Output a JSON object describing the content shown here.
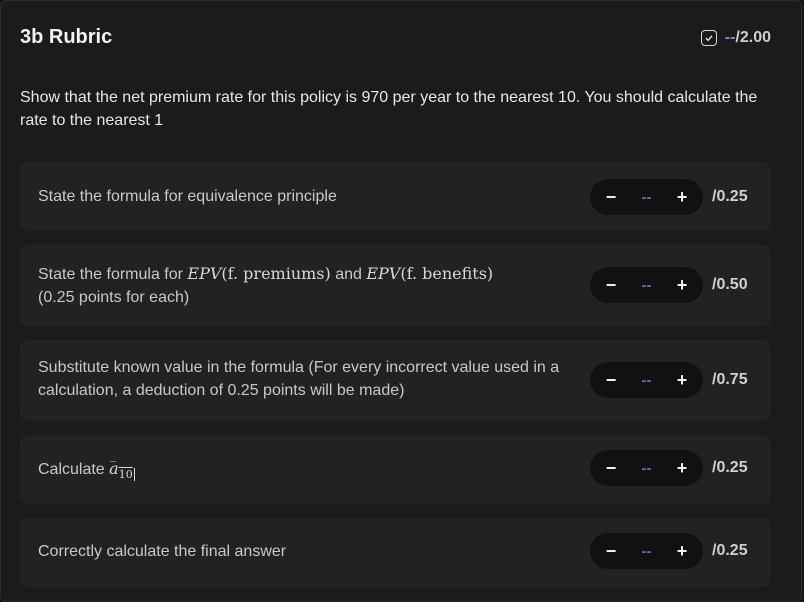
{
  "header": {
    "title": "3b Rubric",
    "score_current": "--",
    "score_max": "/2.00"
  },
  "question": {
    "prompt": "Show that the net premium rate for this policy is 970 per year to the nearest 10. You should calculate the rate to the nearest 1"
  },
  "criteria": [
    {
      "text": "State the formula for equivalence principle",
      "value": "--",
      "max": "/0.25"
    },
    {
      "text_prefix": "State the formula for ",
      "math_1_italic": "EPV",
      "math_1_args": "(f. premiums)",
      "text_mid": " and ",
      "math_2_italic": "EPV",
      "math_2_args": "(f. benefits)",
      "text_suffix": "(0.25 points for each)",
      "value": "--",
      "max": "/0.50"
    },
    {
      "text": "Substitute known value in the formula (For every incorrect value used in a calculation, a deduction of 0.25 points will be made)",
      "value": "--",
      "max": "/0.75"
    },
    {
      "text_prefix": "Calculate ",
      "math_symbol": "a",
      "math_subscript": "10",
      "value": "--",
      "max": "/0.25"
    },
    {
      "text": "Correctly calculate the final answer",
      "value": "--",
      "max": "/0.25"
    }
  ],
  "controls": {
    "decrement_label": "−",
    "increment_label": "+"
  },
  "colors": {
    "background": "#1b1b1b",
    "card": "#222222",
    "stepper_bg": "#111111",
    "placeholder_accent": "#8d87d8"
  },
  "icons": {
    "score_check": "checkbox-check-icon"
  }
}
